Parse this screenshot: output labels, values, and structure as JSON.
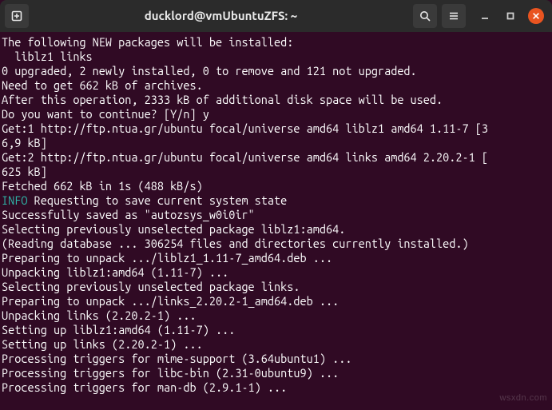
{
  "titlebar": {
    "title": "ducklord@vmUbuntuZFS: ~",
    "new_tab_icon": "new-tab-icon",
    "search_icon": "search-icon",
    "menu_icon": "hamburger-menu-icon",
    "minimize_icon": "minimize-icon",
    "maximize_icon": "maximize-icon",
    "close_icon": "close-icon"
  },
  "terminal": {
    "lines": [
      {
        "t": "The following NEW packages will be installed:"
      },
      {
        "t": "  liblz1 links"
      },
      {
        "t": "0 upgraded, 2 newly installed, 0 to remove and 121 not upgraded."
      },
      {
        "t": "Need to get 662 kB of archives."
      },
      {
        "t": "After this operation, 2333 kB of additional disk space will be used."
      },
      {
        "t": "Do you want to continue? [Y/n] y"
      },
      {
        "t": "Get:1 http://ftp.ntua.gr/ubuntu focal/universe amd64 liblz1 amd64 1.11-7 [3"
      },
      {
        "t": "6,9 kB]"
      },
      {
        "t": "Get:2 http://ftp.ntua.gr/ubuntu focal/universe amd64 links amd64 2.20.2-1 ["
      },
      {
        "t": "625 kB]"
      },
      {
        "t": "Fetched 662 kB in 1s (488 kB/s)"
      },
      {
        "prefix": "INFO",
        "t": " Requesting to save current system state"
      },
      {
        "t": "Successfully saved as \"autozsys_w0i0ir\""
      },
      {
        "t": "Selecting previously unselected package liblz1:amd64."
      },
      {
        "t": "(Reading database ... 306254 files and directories currently installed.)"
      },
      {
        "t": "Preparing to unpack .../liblz1_1.11-7_amd64.deb ..."
      },
      {
        "t": "Unpacking liblz1:amd64 (1.11-7) ..."
      },
      {
        "t": "Selecting previously unselected package links."
      },
      {
        "t": "Preparing to unpack .../links_2.20.2-1_amd64.deb ..."
      },
      {
        "t": "Unpacking links (2.20.2-1) ..."
      },
      {
        "t": "Setting up liblz1:amd64 (1.11-7) ..."
      },
      {
        "t": "Setting up links (2.20.2-1) ..."
      },
      {
        "t": "Processing triggers for mime-support (3.64ubuntu1) ..."
      },
      {
        "t": "Processing triggers for libc-bin (2.31-0ubuntu9) ..."
      },
      {
        "t": "Processing triggers for man-db (2.9.1-1) ..."
      }
    ]
  },
  "watermark": "wsxdn.com"
}
